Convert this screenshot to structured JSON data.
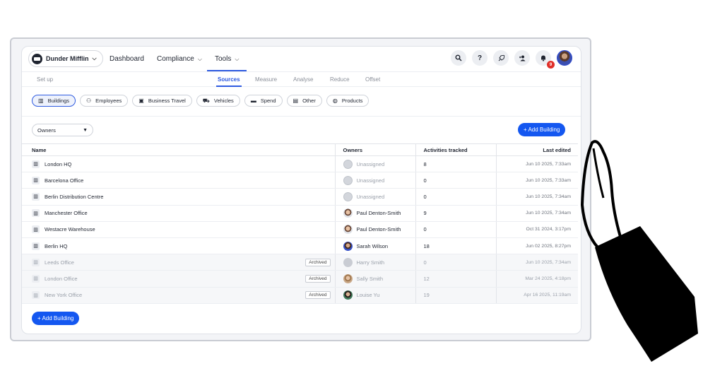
{
  "org": {
    "name": "Dunder Mifflin"
  },
  "nav": {
    "dashboard": "Dashboard",
    "compliance": "Compliance",
    "tools": "Tools"
  },
  "topicons": {
    "help": "?",
    "notif_count": "9"
  },
  "subnav": {
    "setup": "Set up",
    "sources": "Sources",
    "measure": "Measure",
    "analyse": "Analyse",
    "reduce": "Reduce",
    "offset": "Offset"
  },
  "filters": [
    "Buildings",
    "Employees",
    "Business Travel",
    "Vehicles",
    "Spend",
    "Other",
    "Products"
  ],
  "owners_filter": "Owners",
  "add_building": "+ Add Building",
  "table": {
    "headers": {
      "name": "Name",
      "owners": "Owners",
      "activities": "Activities tracked",
      "last_edited": "Last edited"
    },
    "archived_label": "Archived",
    "rows": [
      {
        "name": "London HQ",
        "owner": "Unassigned",
        "activities": "8",
        "edited": "Jun 10 2025, 7:33am"
      },
      {
        "name": "Barcelona Office",
        "owner": "Unassigned",
        "activities": "0",
        "edited": "Jun 10 2025, 7:33am"
      },
      {
        "name": "Berlin Distribution Centre",
        "owner": "Unassigned",
        "activities": "0",
        "edited": "Jun 10 2025, 7:34am"
      },
      {
        "name": "Manchester Office",
        "owner": "Paul Denton-Smith",
        "activities": "9",
        "edited": "Jun 10 2025, 7:34am"
      },
      {
        "name": "Westacre Warehouse",
        "owner": "Paul Denton-Smith",
        "activities": "0",
        "edited": "Oct 31 2024, 3:17pm"
      },
      {
        "name": "Berlin HQ",
        "owner": "Sarah Wilson",
        "activities": "18",
        "edited": "Jun 02 2025, 8:27pm"
      },
      {
        "name": "Leeds Office",
        "owner": "Harry Smith",
        "activities": "0",
        "edited": "Jun 10 2025, 7:34am"
      },
      {
        "name": "London Office",
        "owner": "Sally Smith",
        "activities": "12",
        "edited": "Mar 24 2025, 4:18pm"
      },
      {
        "name": "New York Office",
        "owner": "Louise Yu",
        "activities": "19",
        "edited": "Apr 16 2025, 11:19am"
      }
    ]
  }
}
